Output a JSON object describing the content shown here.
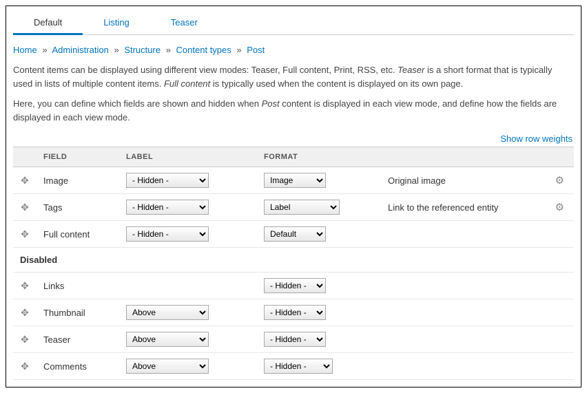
{
  "tabs": [
    {
      "label": "Default",
      "active": true
    },
    {
      "label": "Listing",
      "active": false
    },
    {
      "label": "Teaser",
      "active": false
    }
  ],
  "breadcrumb": {
    "items": [
      "Home",
      "Administration",
      "Structure",
      "Content types",
      "Post"
    ],
    "sep": "»"
  },
  "description": {
    "p1a": "Content items can be displayed using different view modes: Teaser, Full content, Print, RSS, etc. ",
    "p1b_em": "Teaser",
    "p1c": " is a short format that is typically used in lists of multiple content items. ",
    "p1d_em": "Full content",
    "p1e": " is typically used when the content is displayed on its own page.",
    "p2a": "Here, you can define which fields are shown and hidden when ",
    "p2b_em": "Post",
    "p2c": " content is displayed in each view mode, and define how the fields are displayed in each view mode."
  },
  "show_weights": "Show row weights",
  "headers": {
    "field": "FIELD",
    "label": "LABEL",
    "format": "FORMAT"
  },
  "disabled_header": "Disabled",
  "rows": [
    {
      "field": "Image",
      "label": "- Hidden -",
      "format": "Image",
      "summary": "Original image",
      "gear": true
    },
    {
      "field": "Tags",
      "label": "- Hidden -",
      "format": "Label",
      "summary": "Link to the referenced entity",
      "gear": true
    },
    {
      "field": "Full content",
      "label": "- Hidden -",
      "format": "Default",
      "summary": "",
      "gear": false
    }
  ],
  "disabled_rows": [
    {
      "field": "Links",
      "label": "",
      "format": "- Hidden - "
    },
    {
      "field": "Thumbnail",
      "label": "Above",
      "format": "- Hidden - "
    },
    {
      "field": "Teaser",
      "label": "Above",
      "format": "- Hidden - "
    },
    {
      "field": "Comments",
      "label": "Above",
      "format": "- Hidden -"
    }
  ]
}
